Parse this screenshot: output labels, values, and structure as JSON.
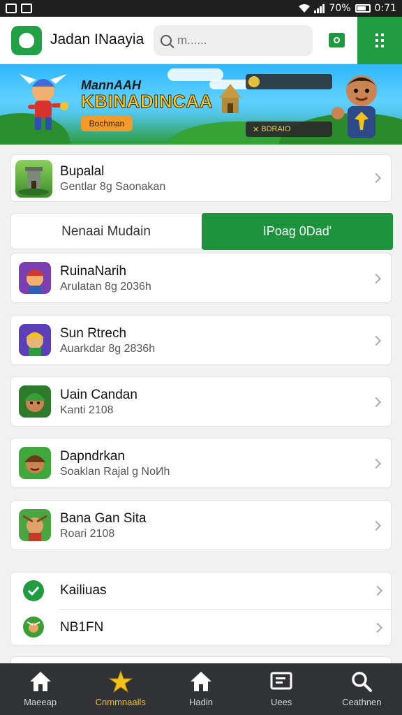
{
  "status_bar": {
    "battery": "70%",
    "time": "0:71"
  },
  "app_bar": {
    "title": "Jadan INaayia",
    "search_placeholder": "m......",
    "accent": "#1e9c3f"
  },
  "banner": {
    "title_line1": "MannAAH",
    "title_line2": "KBINADINCAA",
    "button": "Bochman",
    "chip_text": "BDRAIO"
  },
  "featured": {
    "title": "Bupalal",
    "subtitle": "Gentlar 8g Saonakan"
  },
  "tabs": {
    "left": "Nenaai Mudain",
    "right": "IPoag 0Dad'"
  },
  "list": [
    {
      "title": "RuinaNarih",
      "subtitle": "Arulatan 8g 2036h"
    },
    {
      "title": "Sun Rtrech",
      "subtitle": "Auarkdar 8g 2836h"
    },
    {
      "title": "Uain Candan",
      "subtitle": "Kanti 2108"
    },
    {
      "title": "Dapndrkan",
      "subtitle": "Soaklan Rajal g NoИh"
    },
    {
      "title": "Bana Gan Sita",
      "subtitle": "Roari 2108"
    }
  ],
  "settings": [
    {
      "label": "Kailiuas",
      "icon": "check-circle-icon"
    },
    {
      "label": "NB1FN",
      "icon": "game-leaf-icon"
    }
  ],
  "bottom_nav": [
    {
      "label": "Maeeap",
      "icon": "home-icon"
    },
    {
      "label": "Cnmmnaalls",
      "icon": "star-icon"
    },
    {
      "label": "Hadin",
      "icon": "home-icon"
    },
    {
      "label": "Uees",
      "icon": "library-icon"
    },
    {
      "label": "Ceathnen",
      "icon": "search-icon"
    }
  ]
}
